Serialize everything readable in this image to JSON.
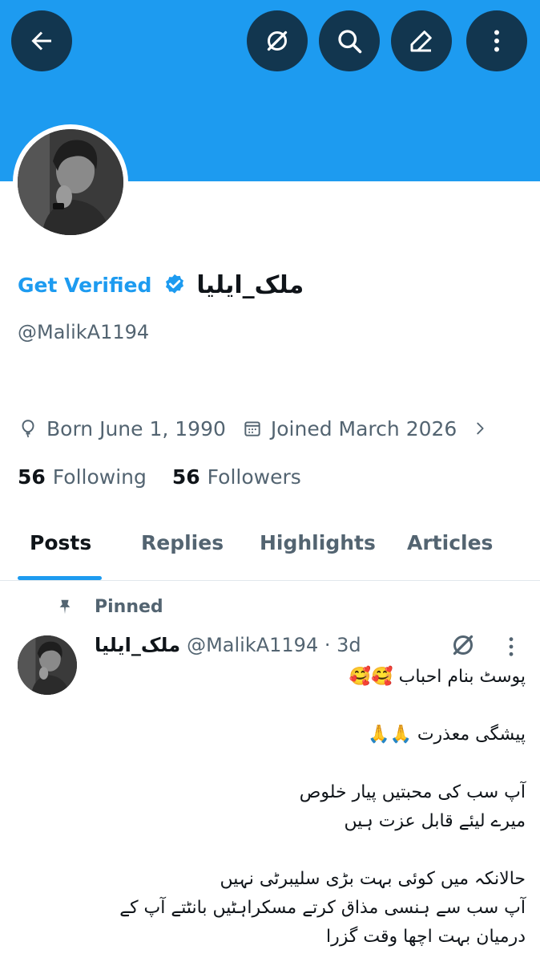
{
  "header": {
    "back_icon": "arrow-left-icon",
    "grok_icon": "grok-icon",
    "search_icon": "search-icon",
    "edit_icon": "edit-pencil-icon",
    "more_icon": "more-vertical-icon",
    "banner_color": "#1d9bf0"
  },
  "profile": {
    "get_verified_label": "Get Verified",
    "display_name": "ملک_ایلیا",
    "handle": "@MalikA1194",
    "born": "Born June 1, 1990",
    "joined": "Joined March 2026",
    "following_count": "56",
    "following_label": "Following",
    "followers_count": "56",
    "followers_label": "Followers"
  },
  "tabs": [
    {
      "label": "Posts",
      "active": true
    },
    {
      "label": "Replies",
      "active": false
    },
    {
      "label": "Highlights",
      "active": false
    },
    {
      "label": "Articles",
      "active": false
    }
  ],
  "post": {
    "pinned_label": "Pinned",
    "author": "ملک_ایلیا",
    "meta": "@MalikA1194 · 3d",
    "lines": [
      "پوسٹ بنام احباب 🥰🥰",
      "",
      "پیشگی معذرت 🙏🙏",
      "",
      "آپ سب کی محبتیں پیار خلوص",
      "میرے لیئے قابل عزت ہیں",
      "",
      "حالانکہ میں کوئی بہت بڑی سلیبرٹی نہیں",
      "آپ سب سے ہنسی مذاق کرتے مسکراہٹیں بانٹتے آپ کے",
      "درمیان بہت اچھا وقت گزرا"
    ]
  },
  "colors": {
    "accent": "#1d9bf0",
    "text_primary": "#0f1419",
    "text_secondary": "#536471"
  }
}
